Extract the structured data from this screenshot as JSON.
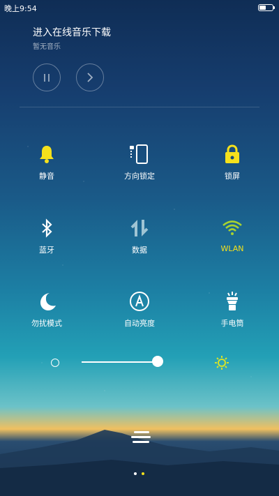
{
  "status_bar": {
    "time": "晚上9:54",
    "battery_icon": "battery-icon"
  },
  "music": {
    "title": "进入在线音乐下载",
    "subtitle": "暂无音乐",
    "pause_icon": "pause-icon",
    "next_icon": "next-icon"
  },
  "tiles": [
    {
      "label": "静音",
      "icon": "bell-icon",
      "active": true
    },
    {
      "label": "方向锁定",
      "icon": "rotation-lock-icon",
      "active": false
    },
    {
      "label": "锁屏",
      "icon": "lock-icon",
      "active": true
    },
    {
      "label": "蓝牙",
      "icon": "bluetooth-icon",
      "active": false
    },
    {
      "label": "数据",
      "icon": "data-icon",
      "active": false
    },
    {
      "label": "WLAN",
      "icon": "wifi-icon",
      "active": true
    },
    {
      "label": "勿扰模式",
      "icon": "moon-icon",
      "active": false
    },
    {
      "label": "自动亮度",
      "icon": "auto-brightness-icon",
      "active": false
    },
    {
      "label": "手电筒",
      "icon": "flashlight-icon",
      "active": false
    }
  ],
  "brightness": {
    "level": 0.87
  },
  "colors": {
    "active": "#f5e11c",
    "inactive": "#ffffff"
  },
  "pager": {
    "pages": 2,
    "current": 2
  }
}
